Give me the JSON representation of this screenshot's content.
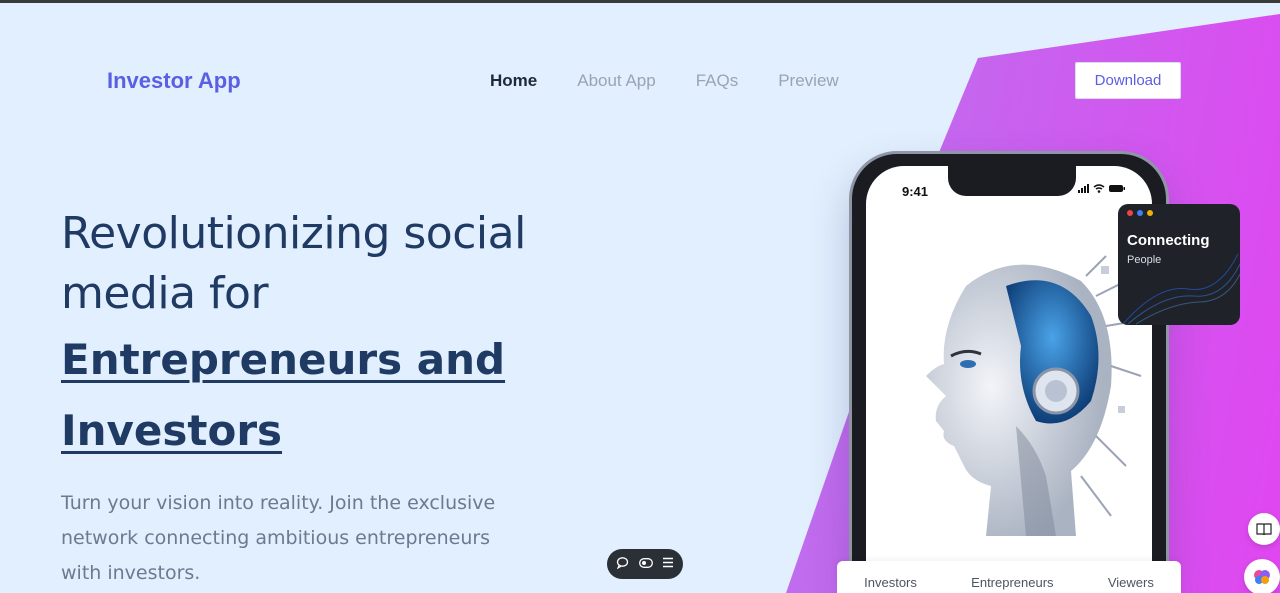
{
  "brand": {
    "name": "Investor App",
    "color": "#5a5fe3"
  },
  "nav": {
    "items": [
      {
        "label": "Home",
        "active": true
      },
      {
        "label": "About App",
        "active": false
      },
      {
        "label": "FAQs",
        "active": false
      },
      {
        "label": "Preview",
        "active": false
      }
    ],
    "download_label": "Download"
  },
  "hero": {
    "line1": "Revolutionizing social",
    "line2": "media for",
    "highlight1": "Entrepreneurs and",
    "highlight2": "Investors",
    "lead": "Turn your vision into reality. Join the exclusive network connecting ambitious entrepreneurs with investors."
  },
  "phone": {
    "time": "9:41",
    "status_icons": "signal wifi battery"
  },
  "card": {
    "title": "Connecting",
    "subtitle": "People"
  },
  "tabs": [
    "Investors",
    "Entrepreneurs",
    "Viewers"
  ],
  "toolbar": {
    "icons": [
      "chat-icon",
      "toggle-icon",
      "menu-icon"
    ]
  },
  "side": {
    "icons": [
      "book-icon",
      "brain-icon"
    ]
  }
}
